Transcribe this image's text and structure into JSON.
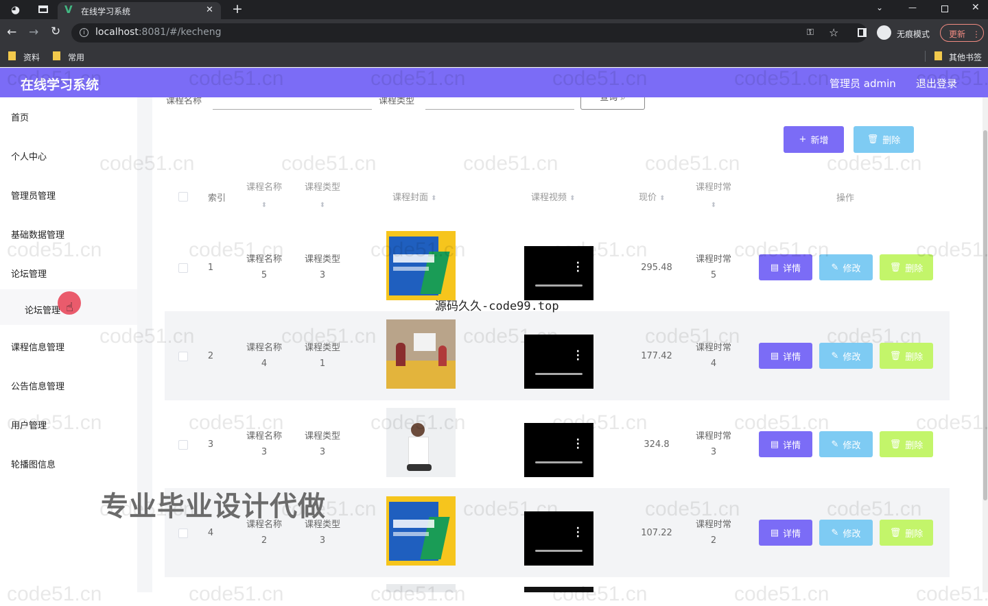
{
  "browser": {
    "tab_title": "在线学习系统",
    "url_host": "localhost",
    "url_rest": ":8081/#/kecheng",
    "profile_label": "无痕模式",
    "update_label": "更新",
    "bookmarks": [
      "资料",
      "常用"
    ],
    "other_bookmarks": "其他书签"
  },
  "app": {
    "title": "在线学习系统",
    "user_label": "管理员 admin",
    "logout": "退出登录",
    "accent": "#7b6cf6"
  },
  "sidebar": {
    "items": [
      "首页",
      "个人中心",
      "管理员管理",
      "基础数据管理",
      "论坛管理",
      "论坛管理",
      "课程信息管理",
      "公告信息管理",
      "用户管理",
      "轮播图信息"
    ]
  },
  "search": {
    "name_label": "课程名称",
    "type_label": "课程类型",
    "query_button": "查询"
  },
  "toolbar": {
    "add": "新增",
    "delete": "删除"
  },
  "table": {
    "headers": {
      "index": "索引",
      "name": "课程名称",
      "type": "课程类型",
      "cover": "课程封面",
      "video": "课程视频",
      "price": "现价",
      "duration": "课程时常",
      "actions": "操作"
    },
    "rows": [
      {
        "index": "1",
        "name_label": "课程名称",
        "name_value": "5",
        "type_label": "课程类型",
        "type_value": "3",
        "cover": "math",
        "price": "295.48",
        "dur_label": "课程时常",
        "dur_value": "5"
      },
      {
        "index": "2",
        "name_label": "课程名称",
        "name_value": "4",
        "type_label": "课程类型",
        "type_value": "1",
        "cover": "class",
        "price": "177.42",
        "dur_label": "课程时常",
        "dur_value": "4"
      },
      {
        "index": "3",
        "name_label": "课程名称",
        "name_value": "3",
        "type_label": "课程类型",
        "type_value": "3",
        "cover": "teacher",
        "price": "324.8",
        "dur_label": "课程时常",
        "dur_value": "3"
      },
      {
        "index": "4",
        "name_label": "课程名称",
        "name_value": "2",
        "type_label": "课程类型",
        "type_value": "3",
        "cover": "math",
        "price": "107.22",
        "dur_label": "课程时常",
        "dur_value": "2"
      }
    ],
    "row_actions": {
      "detail": "详情",
      "edit": "修改",
      "delete": "删除"
    }
  },
  "overlays": {
    "watermark": "code51.cn",
    "source_text": "源码久久-code99.top",
    "ad_text": "专业毕业设计代做"
  }
}
